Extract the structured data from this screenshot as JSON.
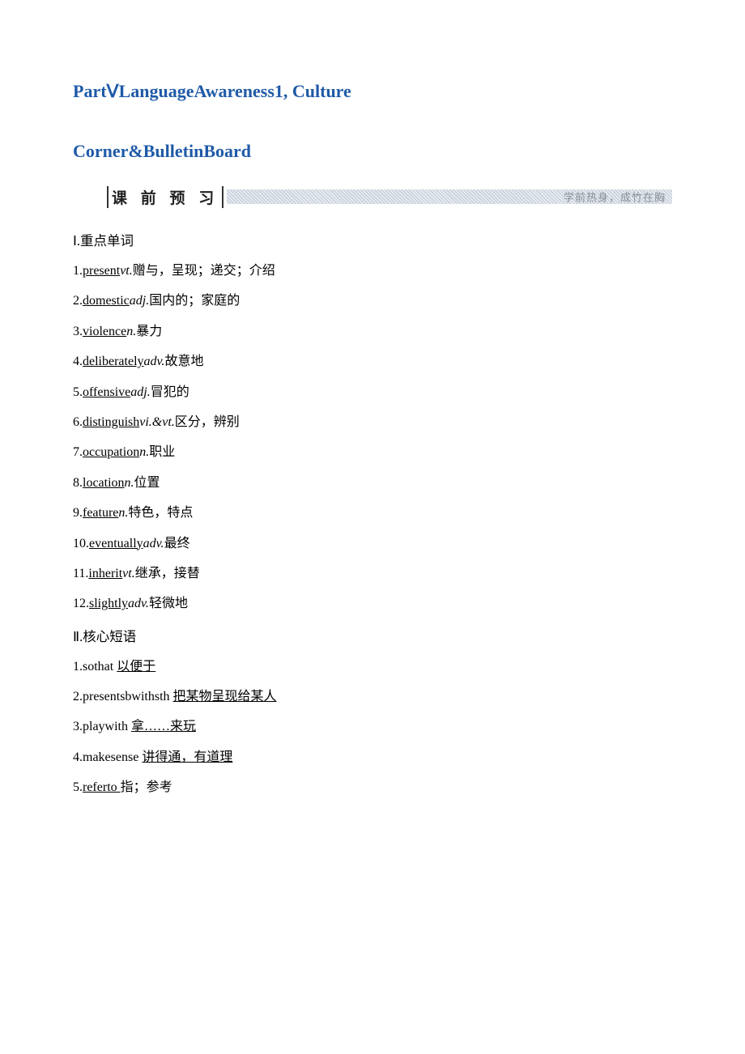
{
  "title": "PartⅤLanguageAwareness1, Culture",
  "subtitle": "Corner&BulletinBoard",
  "previewBar": {
    "label": "课 前 预 习",
    "note": "学前热身，成竹在胸"
  },
  "section1": {
    "heading": "Ⅰ.重点单词",
    "items": [
      {
        "num": "1.",
        "word": "present",
        "pos": "vt.",
        "def": "赠与，呈现；递交；介绍"
      },
      {
        "num": "2.",
        "word": "domestic",
        "pos": "adj.",
        "def": "国内的；家庭的"
      },
      {
        "num": "3.",
        "word": "violence",
        "pos": "n.",
        "def": "暴力"
      },
      {
        "num": "4.",
        "word": "deliberately",
        "pos": "adv.",
        "def": "故意地"
      },
      {
        "num": "5.",
        "word": "offensive",
        "pos": "adj.",
        "def": "冒犯的"
      },
      {
        "num": "6.",
        "word": "distinguish",
        "pos": "vi.&vt.",
        "def": "区分，辨别"
      },
      {
        "num": "7.",
        "word": "occupation",
        "pos": "n.",
        "def": "职业"
      },
      {
        "num": "8.",
        "word": "location",
        "pos": "n.",
        "def": "位置"
      },
      {
        "num": "9.",
        "word": "feature",
        "pos": "n.",
        "def": "特色，特点"
      },
      {
        "num": "10.",
        "word": "eventually",
        "pos": "adv.",
        "def": "最终"
      },
      {
        "num": "11.",
        "word": "inherit",
        "pos": "vt.",
        "def": "继承，接替"
      },
      {
        "num": "12.",
        "word": "slightly",
        "pos": "adv.",
        "def": "轻微地"
      }
    ]
  },
  "section2": {
    "heading": "Ⅱ.核心短语",
    "items": [
      {
        "num": "1.",
        "phrase": "sothat ",
        "def": "以便于",
        "ul": "def"
      },
      {
        "num": "2.",
        "phrase": "presentsbwithsth ",
        "def": "把某物呈现给某人",
        "ul": "def"
      },
      {
        "num": "3.",
        "phrase": "playwith ",
        "def": "拿……来玩",
        "ul": "def"
      },
      {
        "num": "4.",
        "phrase": "makesense ",
        "def": "讲得通，有道理",
        "ul": "def"
      },
      {
        "num": "5.",
        "phrase": "referto ",
        "def": "指；参考",
        "ul": "phrase"
      }
    ]
  }
}
